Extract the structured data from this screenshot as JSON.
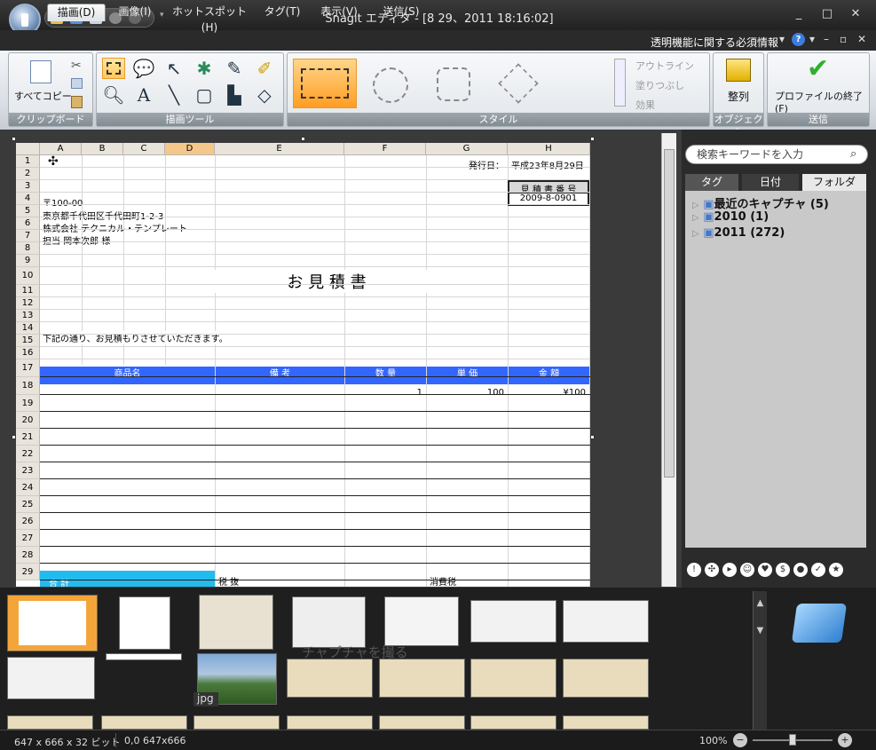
{
  "window": {
    "title": "Snagit エディタ - [8 29、2011 18:16:02]",
    "controls": [
      "_",
      "□",
      "✕"
    ]
  },
  "tabs": [
    {
      "label": "描画(D)",
      "active": true
    },
    {
      "label": "画像(I)"
    },
    {
      "label": "ホットスポット(H)"
    },
    {
      "label": "タグ(T)"
    },
    {
      "label": "表示(V)"
    },
    {
      "label": "送信(S)"
    }
  ],
  "help_info": "透明機能に関する必須情報",
  "ribbon": {
    "clipboard": {
      "group_label": "クリップボード",
      "copy_all": "すべてコピー"
    },
    "draw_tools": {
      "group_label": "描画ツール"
    },
    "style": {
      "group_label": "スタイル",
      "outline": "アウトライン",
      "fill": "塗りつぶし",
      "effects": "効果"
    },
    "object": {
      "group_label": "オブジェクト",
      "arrange": "整列"
    },
    "send": {
      "group_label": "送信",
      "finish_profile": "プロファイルの終了(F)"
    }
  },
  "sheet": {
    "columns": [
      "A",
      "B",
      "C",
      "D",
      "E",
      "F",
      "G",
      "H"
    ],
    "rows": [
      "1",
      "2",
      "3",
      "4",
      "5",
      "6",
      "7",
      "8",
      "9",
      "10",
      "11",
      "12",
      "13",
      "14",
      "15",
      "16",
      "17",
      "18",
      "19",
      "20",
      "21",
      "22",
      "23",
      "24",
      "25",
      "26",
      "27",
      "28",
      "29"
    ],
    "issue_date_label": "発行日：",
    "issue_date": "平成23年8月29日",
    "estimate_no_label": "見 積 書 番 号",
    "estimate_no": "2009-8-0901",
    "postal": "〒100-00",
    "address": "東京都千代田区千代田町1-2-3",
    "company": "株式会社 テクニカル・テンプレート",
    "person": "担当 岡本次郎 様",
    "heading": "お 見 積 書",
    "message": "下記の通り、お見積もりさせていただきます。",
    "table_headers": [
      "商品名",
      "備 考",
      "数 量",
      "単 価",
      "金 額"
    ],
    "row18": {
      "qty": "1",
      "price": "100",
      "amount": "¥100"
    },
    "total_label": "合 計",
    "tax_excl": "税 抜",
    "tax": "消費税"
  },
  "right_pane": {
    "search_placeholder": "検索キーワードを入力",
    "tabs": [
      "タグ",
      "日付",
      "フォルダ"
    ],
    "tree": [
      "最近のキャプチャ (5)",
      "2010 (1)",
      "2011 (272)"
    ]
  },
  "tray": {
    "jpg_label": "jpg",
    "watermark": "チャプチャを撮る"
  },
  "status": {
    "image_info": "647 x 666 x 32 ビット",
    "coords": "0,0  647x666",
    "zoom": "100%"
  }
}
